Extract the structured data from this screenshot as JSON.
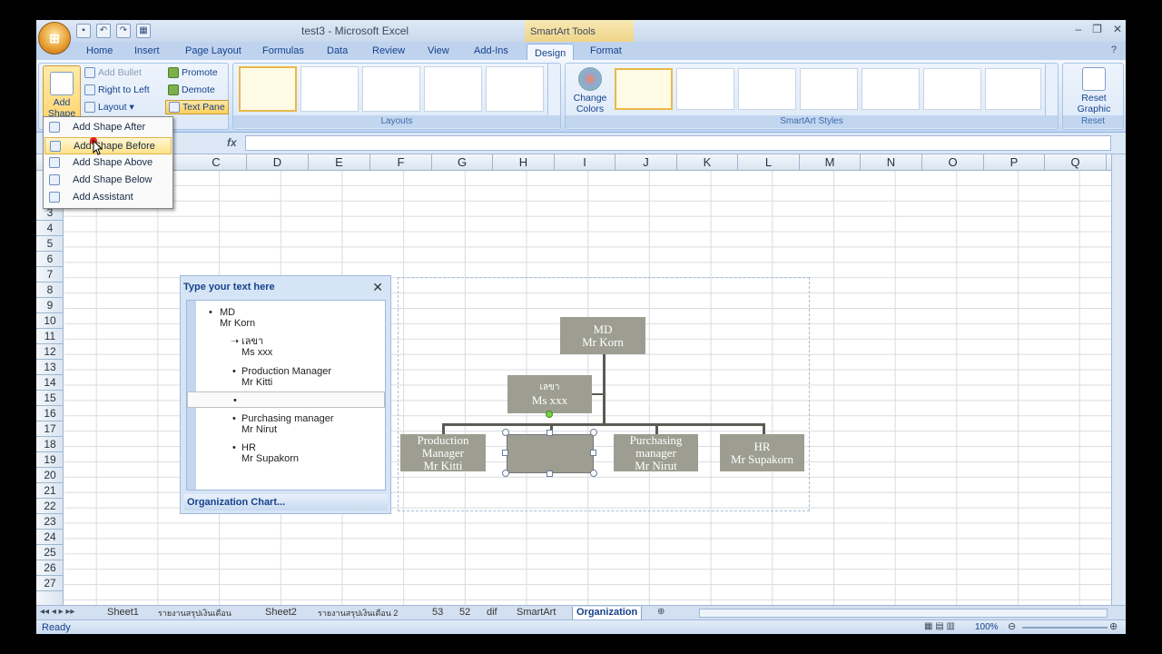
{
  "window": {
    "title": "test3 - Microsoft Excel",
    "tools_title": "SmartArt Tools"
  },
  "tabs": [
    "Home",
    "Insert",
    "Page Layout",
    "Formulas",
    "Data",
    "Review",
    "View",
    "Add-Ins",
    "Design",
    "Format"
  ],
  "ribbon": {
    "create_graphic": {
      "add_shape": "Add Shape",
      "add_bullet": "Add Bullet",
      "right_to_left": "Right to Left",
      "layout": "Layout",
      "promote": "Promote",
      "demote": "Demote",
      "text_pane": "Text Pane"
    },
    "layouts_label": "Layouts",
    "change_colors": "Change Colors",
    "styles_label": "SmartArt Styles",
    "reset_graphic": "Reset Graphic",
    "reset_label": "Reset"
  },
  "formula_bar": {
    "fx": "fx",
    "value": ""
  },
  "dropdown": {
    "items": [
      "Add Shape After",
      "Add Shape Before",
      "Add Shape Above",
      "Add Shape Below",
      "Add Assistant"
    ]
  },
  "columns": [
    "C",
    "D",
    "E",
    "F",
    "G",
    "H",
    "I",
    "J",
    "K",
    "L",
    "M",
    "N",
    "O",
    "P",
    "Q"
  ],
  "rows": [
    "3",
    "4",
    "5",
    "6",
    "7",
    "8",
    "9",
    "10",
    "11",
    "12",
    "13",
    "14",
    "15",
    "16",
    "17",
    "18",
    "19",
    "20",
    "21",
    "22",
    "23",
    "24",
    "25",
    "26",
    "27"
  ],
  "text_pane": {
    "title": "Type your text here",
    "items": [
      {
        "title": "MD",
        "sub": "Mr Korn"
      },
      {
        "title": "เลขา",
        "sub": "Ms xxx"
      },
      {
        "title": "Production Manager",
        "sub": "Mr Kitti"
      },
      {
        "title": "",
        "sub": ""
      },
      {
        "title": "Purchasing manager",
        "sub": "Mr Nirut"
      },
      {
        "title": "HR",
        "sub": "Mr Supakorn"
      }
    ],
    "footer": "Organization Chart..."
  },
  "org_chart": {
    "md": [
      "MD",
      "Mr Korn"
    ],
    "assistant": [
      "เลขา",
      "Ms xxx"
    ],
    "production": [
      "Production",
      "Manager",
      "Mr Kitti"
    ],
    "purchasing": [
      "Purchasing",
      "manager",
      "Mr Nirut"
    ],
    "hr": [
      "HR",
      "Mr Supakorn"
    ]
  },
  "sheet_tabs": [
    "Sheet1",
    "รายงานสรุปเงินเดือน",
    "Sheet2",
    "รายงานสรุปเงินเดือน 2",
    "53",
    "52",
    "dif",
    "SmartArt",
    "Organization"
  ],
  "active_sheet": "Organization",
  "status": {
    "ready": "Ready",
    "zoom": "100%"
  }
}
